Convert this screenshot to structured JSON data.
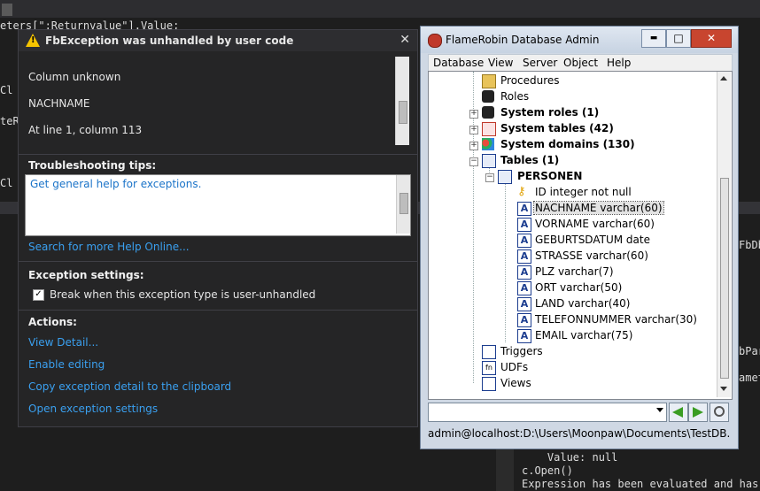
{
  "background_code": {
    "line1": "eters[\":Returnvalue\"].Value;",
    "line2": "Cl",
    "line3": "teR",
    "line4": "Cl",
    "right1": "FbDb",
    "right2": "bPar",
    "right3": "amet",
    "bottom1": "    Value: null",
    "bottom2": "c.Open()",
    "bottom3": "Expression has been evaluated and has r"
  },
  "exception": {
    "title": "FbException was unhandled by user code",
    "message_lines": [
      "Column unknown",
      "NACHNAME",
      "At line 1, column 113"
    ],
    "troubleshooting_heading": "Troubleshooting tips:",
    "tip_link": "Get general help for exceptions.",
    "search_link": "Search for more Help Online...",
    "settings_heading": "Exception settings:",
    "break_checkbox_label": "Break when this exception type is user-unhandled",
    "break_checked": true,
    "actions_heading": "Actions:",
    "actions": [
      "View Detail...",
      "Enable editing",
      "Copy exception detail to the clipboard",
      "Open exception settings"
    ]
  },
  "flamerobin": {
    "title": "FlameRobin Database Admin",
    "menu": [
      "Database",
      "View",
      "Server",
      "Object",
      "Help"
    ],
    "tree": {
      "procedures": "Procedures",
      "roles": "Roles",
      "system_roles": "System roles (1)",
      "system_tables": "System tables (42)",
      "system_domains": "System domains (130)",
      "tables": "Tables (1)",
      "table_name": "PERSONEN",
      "columns": [
        "ID integer not null",
        "NACHNAME varchar(60)",
        "VORNAME varchar(60)",
        "GEBURTSDATUM date",
        "STRASSE varchar(60)",
        "PLZ varchar(7)",
        "ORT varchar(50)",
        "LAND varchar(40)",
        "TELEFONNUMMER varchar(30)",
        "EMAIL varchar(75)"
      ],
      "triggers": "Triggers",
      "udfs": "UDFs",
      "views": "Views"
    },
    "status": "admin@localhost:D:\\Users\\Moonpaw\\Documents\\TestDB...",
    "window_buttons": {
      "minimize": "▬",
      "maximize": "□",
      "close": "✕"
    }
  }
}
